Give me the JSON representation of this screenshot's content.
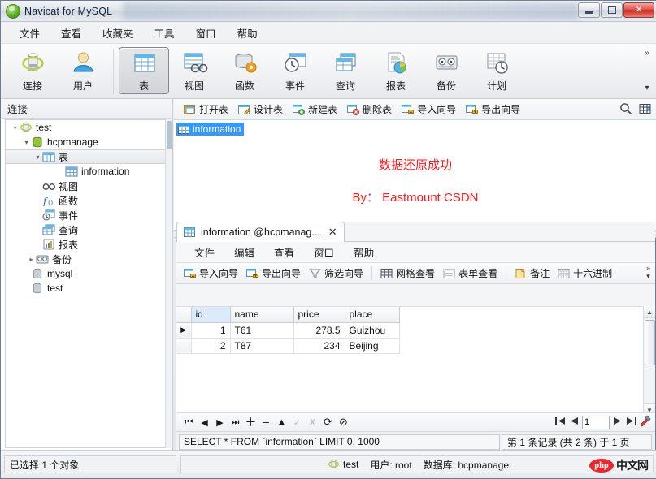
{
  "window": {
    "title": "Navicat for MySQL",
    "icon": "navicat-logo-icon",
    "buttons": {
      "minimize": "—",
      "maximize": "□",
      "close": "✕"
    }
  },
  "menubar": {
    "items": [
      {
        "label": "文件",
        "name": "menu-file"
      },
      {
        "label": "查看",
        "name": "menu-view"
      },
      {
        "label": "收藏夹",
        "name": "menu-favorites"
      },
      {
        "label": "工具",
        "name": "menu-tools"
      },
      {
        "label": "窗口",
        "name": "menu-window"
      },
      {
        "label": "帮助",
        "name": "menu-help"
      }
    ]
  },
  "toolbar": {
    "buttons": [
      {
        "label": "连接",
        "icon": "connection-icon",
        "active": false
      },
      {
        "label": "用户",
        "icon": "user-icon",
        "active": false
      },
      {
        "label": "表",
        "icon": "table-icon",
        "active": true
      },
      {
        "label": "视图",
        "icon": "view-icon",
        "active": false
      },
      {
        "label": "函数",
        "icon": "function-icon",
        "active": false
      },
      {
        "label": "事件",
        "icon": "event-icon",
        "active": false
      },
      {
        "label": "查询",
        "icon": "query-icon",
        "active": false
      },
      {
        "label": "报表",
        "icon": "report-icon",
        "active": false
      },
      {
        "label": "备份",
        "icon": "backup-icon",
        "active": false
      },
      {
        "label": "计划",
        "icon": "schedule-icon",
        "active": false
      }
    ],
    "overflow_more": "»",
    "overflow_down": "▾"
  },
  "sidebar": {
    "header": "连接",
    "tree": [
      {
        "label": "test",
        "icon": "connection-icon",
        "indent": 0,
        "arrow": "▾",
        "selected": false
      },
      {
        "label": "hcpmanage",
        "icon": "database-active-icon",
        "indent": 1,
        "arrow": "▾",
        "selected": false
      },
      {
        "label": "表",
        "icon": "table-folder-icon",
        "indent": 2,
        "arrow": "▾",
        "selected": true
      },
      {
        "label": "information",
        "icon": "table-icon",
        "indent": 3,
        "arrow": "",
        "selected": false
      },
      {
        "label": "视图",
        "icon": "view-icon",
        "indent": 2,
        "arrow": "",
        "selected": false
      },
      {
        "label": "函数",
        "icon": "function-icon",
        "indent": 2,
        "arrow": "",
        "selected": false
      },
      {
        "label": "事件",
        "icon": "event-icon",
        "indent": 2,
        "arrow": "",
        "selected": false
      },
      {
        "label": "查询",
        "icon": "query-icon",
        "indent": 2,
        "arrow": "",
        "selected": false
      },
      {
        "label": "报表",
        "icon": "report-icon",
        "indent": 2,
        "arrow": "",
        "selected": false
      },
      {
        "label": "备份",
        "icon": "backup-icon",
        "indent": 2,
        "arrow": "▸",
        "selected": false
      },
      {
        "label": "mysql",
        "icon": "database-icon",
        "indent": 1,
        "arrow": "",
        "selected": false
      },
      {
        "label": "test",
        "icon": "database-icon",
        "indent": 1,
        "arrow": "",
        "selected": false
      }
    ]
  },
  "object_toolbar": {
    "buttons": [
      {
        "label": "打开表",
        "icon": "open-table-icon"
      },
      {
        "label": "设计表",
        "icon": "design-table-icon"
      },
      {
        "label": "新建表",
        "icon": "new-table-icon"
      },
      {
        "label": "删除表",
        "icon": "delete-table-icon"
      },
      {
        "label": "导入向导",
        "icon": "import-wizard-icon"
      },
      {
        "label": "导出向导",
        "icon": "export-wizard-icon"
      }
    ],
    "search_icon": "search-icon",
    "viewmode_icon": "grid-view-icon"
  },
  "object_list": {
    "selected_item": {
      "label": "information",
      "icon": "table-icon"
    },
    "messages": [
      "数据还原成功",
      "By： Eastmount CSDN"
    ],
    "message_color": "#fb1b1b"
  },
  "child_window": {
    "tab": {
      "label": "information @hcpmanag...",
      "icon": "table-icon",
      "close": "✕"
    },
    "menubar": [
      {
        "label": "文件",
        "name": "cmenu-file"
      },
      {
        "label": "编辑",
        "name": "cmenu-edit"
      },
      {
        "label": "查看",
        "name": "cmenu-view"
      },
      {
        "label": "窗口",
        "name": "cmenu-window"
      },
      {
        "label": "帮助",
        "name": "cmenu-help"
      }
    ],
    "toolbar": [
      {
        "label": "导入向导",
        "icon": "import-wizard-icon"
      },
      {
        "label": "导出向导",
        "icon": "export-wizard-icon"
      },
      {
        "label": "筛选向导",
        "icon": "filter-wizard-icon"
      },
      {
        "label": "网格查看",
        "icon": "grid-view-icon"
      },
      {
        "label": "表单查看",
        "icon": "form-view-icon"
      },
      {
        "label": "备注",
        "icon": "memo-icon"
      },
      {
        "label": "十六进制",
        "icon": "hex-icon"
      }
    ],
    "toolbar_overflow": {
      "more": "»",
      "down": "▾"
    },
    "grid": {
      "columns": [
        "id",
        "name",
        "price",
        "place"
      ],
      "rows": [
        {
          "marker": "▶",
          "id": "1",
          "name": "T61",
          "price": "278.5",
          "place": "Guizhou"
        },
        {
          "marker": "",
          "id": "2",
          "name": "T87",
          "price": "234",
          "place": "Beijing"
        }
      ]
    },
    "navbar": {
      "buttons": [
        {
          "icon": "first-record-icon",
          "glyph": "⏮",
          "dim": false
        },
        {
          "icon": "prev-record-icon",
          "glyph": "◀",
          "dim": false
        },
        {
          "icon": "next-record-icon",
          "glyph": "▶",
          "dim": false
        },
        {
          "icon": "last-record-icon",
          "glyph": "⏭",
          "dim": false
        },
        {
          "icon": "add-record-icon",
          "glyph": "＋",
          "dim": false
        },
        {
          "icon": "delete-record-icon",
          "glyph": "−",
          "dim": false
        },
        {
          "icon": "apply-change-icon",
          "glyph": "▲",
          "dim": false
        },
        {
          "icon": "confirm-edit-icon",
          "glyph": "✓",
          "dim": true
        },
        {
          "icon": "cancel-edit-icon",
          "glyph": "✗",
          "dim": true
        },
        {
          "icon": "refresh-icon",
          "glyph": "⟳",
          "dim": false
        },
        {
          "icon": "stop-icon",
          "glyph": "⊘",
          "dim": false
        }
      ],
      "page_first_icon": "page-first-icon",
      "page_prev_icon": "page-prev-icon",
      "page_value": "1",
      "page_next_icon": "page-next-icon",
      "page_last_icon": "page-last-icon",
      "settings_icon": "tools-icon"
    },
    "status": {
      "sql": "SELECT * FROM `information` LIMIT 0, 1000",
      "records": "第 1 条记录 (共 2 条) 于 1 页"
    }
  },
  "statusbar": {
    "left": "已选择 1 个对象",
    "connection_icon": "connection-icon",
    "connection": "test",
    "user": "用户: root",
    "database": "数据库: hcpmanage",
    "watermark": {
      "badge": "php",
      "text": "中文网"
    }
  }
}
